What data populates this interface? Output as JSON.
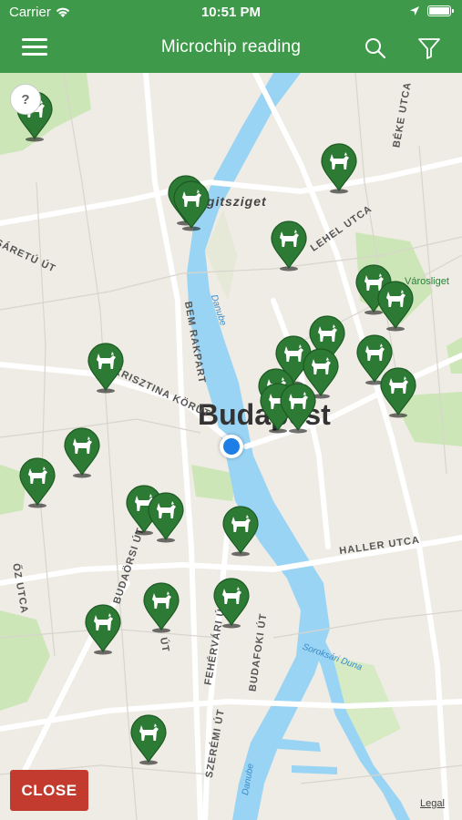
{
  "status_bar": {
    "carrier": "Carrier",
    "time": "10:51 PM"
  },
  "navbar": {
    "title": "Microchip reading",
    "icons": [
      "menu-icon",
      "search-icon",
      "filter-icon"
    ]
  },
  "map": {
    "city_label": "Budapest",
    "island_label": "Margitsziget",
    "park_label": "Városliget",
    "water_labels": [
      "Danube",
      "Soroksári Duna",
      "Danube"
    ],
    "street_labels": [
      "BÉKE UTCA",
      "LEHEL UTCA",
      "SÁRETÚ ÚT",
      "BEM RAKPART",
      "KRISZTINA KÖRÚT",
      "HALLER UTCA",
      "BUDAÖRSI ÚT",
      "FEHÉRVÁRI ÚT",
      "BUDAFOKI ÚT",
      "SZERÉMI ÚT",
      "ŐZ UTCA",
      "ÚT"
    ],
    "pin_icon": "dog-icon",
    "pin_color": "#2d7a35",
    "pin_count": 30
  },
  "help_label": "?",
  "close_label": "CLOSE",
  "legal_label": "Legal",
  "colors": {
    "header": "#3e9a4a",
    "close": "#c33b2e",
    "water": "#9ad4f5",
    "park": "#cde6b8",
    "location": "#1f7de6"
  }
}
